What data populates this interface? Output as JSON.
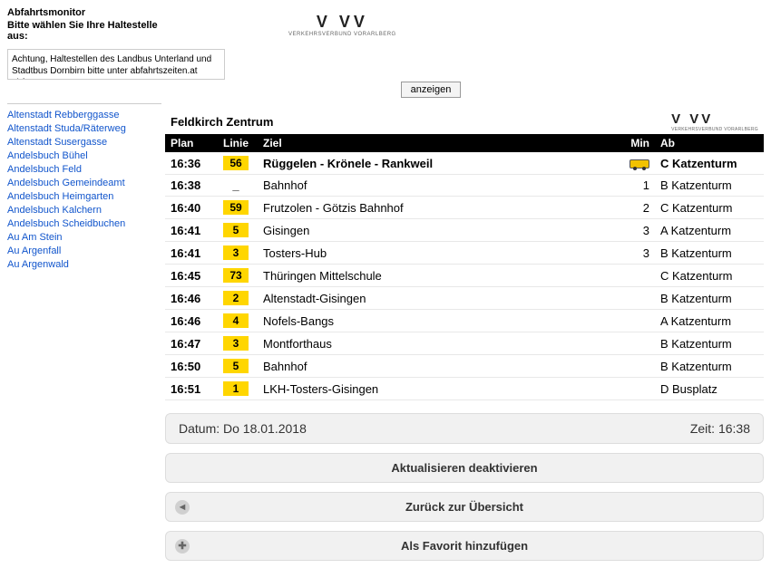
{
  "header": {
    "title": "Abfahrtsmonitor",
    "subtitle": "Bitte wählen Sie Ihre Haltestelle aus:",
    "notice": "Achtung, Haltestellen des Landbus Unterland und Stadtbus Dornbirn bitte unter abfahrtszeiten.at abfragen",
    "logo_main": "V  VV",
    "logo_sub": "VERKEHRSVERBUND VORARLBERG",
    "show_button": "anzeigen"
  },
  "sidebar": {
    "items": [
      "Altenstadt Rebberggasse",
      "Altenstadt Studa/Räterweg",
      "Altenstadt Susergasse",
      "Andelsbuch Bühel",
      "Andelsbuch Feld",
      "Andelsbuch Gemeindeamt",
      "Andelsbuch Heimgarten",
      "Andelsbuch Kalchern",
      "Andelsbuch Scheidbuchen",
      "Au Am Stein",
      "Au Argenfall",
      "Au Argenwald"
    ]
  },
  "board": {
    "stop_name": "Feldkirch Zentrum",
    "columns": {
      "plan": "Plan",
      "linie": "Linie",
      "ziel": "Ziel",
      "min": "Min",
      "ab": "Ab"
    },
    "rows": [
      {
        "plan": "16:36",
        "linie": "56",
        "linie_style": "badge",
        "ziel": "Rüggelen - Krönele - Rankweil",
        "min_icon": true,
        "min": "",
        "ab": "C Katzenturm"
      },
      {
        "plan": "16:38",
        "linie": "_",
        "linie_style": "plain",
        "ziel": "Bahnhof",
        "min": "1",
        "ab": "B Katzenturm"
      },
      {
        "plan": "16:40",
        "linie": "59",
        "linie_style": "badge",
        "ziel": "Frutzolen - Götzis Bahnhof",
        "min": "2",
        "ab": "C Katzenturm"
      },
      {
        "plan": "16:41",
        "linie": "5",
        "linie_style": "badge",
        "ziel": "Gisingen",
        "min": "3",
        "ab": "A Katzenturm"
      },
      {
        "plan": "16:41",
        "linie": "3",
        "linie_style": "badge",
        "ziel": "Tosters-Hub",
        "min": "3",
        "ab": "B Katzenturm"
      },
      {
        "plan": "16:45",
        "linie": "73",
        "linie_style": "badge",
        "ziel": "Thüringen Mittelschule",
        "min": "",
        "ab": "C Katzenturm"
      },
      {
        "plan": "16:46",
        "linie": "2",
        "linie_style": "badge",
        "ziel": "Altenstadt-Gisingen",
        "min": "",
        "ab": "B Katzenturm"
      },
      {
        "plan": "16:46",
        "linie": "4",
        "linie_style": "badge",
        "ziel": "Nofels-Bangs",
        "min": "",
        "ab": "A Katzenturm"
      },
      {
        "plan": "16:47",
        "linie": "3",
        "linie_style": "badge",
        "ziel": "Montforthaus",
        "min": "",
        "ab": "B Katzenturm"
      },
      {
        "plan": "16:50",
        "linie": "5",
        "linie_style": "badge",
        "ziel": "Bahnhof",
        "min": "",
        "ab": "B Katzenturm"
      },
      {
        "plan": "16:51",
        "linie": "1",
        "linie_style": "badge",
        "ziel": "LKH-Tosters-Gisingen",
        "min": "",
        "ab": "D Busplatz"
      }
    ]
  },
  "status": {
    "date_label": "Datum: Do 18.01.2018",
    "time_label": "Zeit: 16:38"
  },
  "actions": {
    "toggle_refresh": "Aktualisieren deaktivieren",
    "back": "Zurück zur Übersicht",
    "favorite": "Als Favorit hinzufügen"
  }
}
